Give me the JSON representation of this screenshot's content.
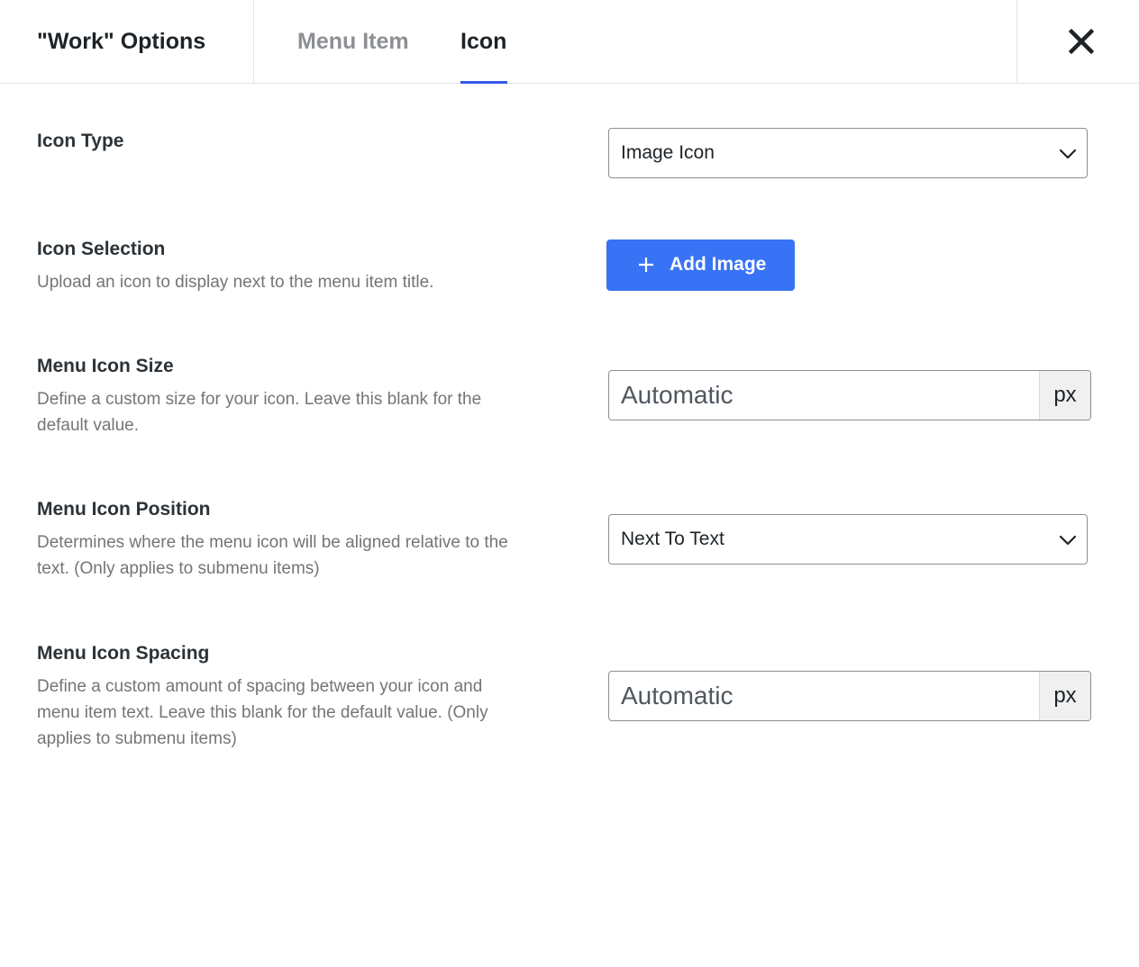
{
  "header": {
    "title": "\"Work\" Options",
    "tabs": [
      {
        "label": "Menu Item",
        "active": false
      },
      {
        "label": "Icon",
        "active": true
      }
    ],
    "close_icon": "close-icon"
  },
  "colors": {
    "accent": "#3858e9",
    "button": "#3873f5",
    "label": "#2c3338",
    "description": "#757575",
    "inactive_tab": "#8c8f94"
  },
  "settings": {
    "icon_type": {
      "label": "Icon Type",
      "value": "Image Icon"
    },
    "icon_selection": {
      "label": "Icon Selection",
      "description": "Upload an icon to display next to the menu item title.",
      "button_label": "Add Image",
      "button_icon": "plus-icon"
    },
    "icon_size": {
      "label": "Menu Icon Size",
      "description": "Define a custom size for your icon. Leave this blank for the default value.",
      "placeholder": "Automatic",
      "unit": "px"
    },
    "icon_position": {
      "label": "Menu Icon Position",
      "description": "Determines where the menu icon will be aligned relative to the text. (Only applies to submenu items)",
      "value": "Next To Text"
    },
    "icon_spacing": {
      "label": "Menu Icon Spacing",
      "description": "Define a custom amount of spacing between your icon and menu item text. Leave this blank for the default value. (Only applies to submenu items)",
      "placeholder": "Automatic",
      "unit": "px"
    }
  }
}
